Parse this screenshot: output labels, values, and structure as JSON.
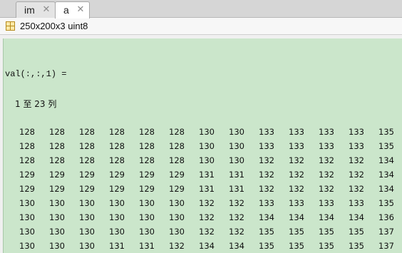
{
  "tabs": [
    {
      "label": "im",
      "active": false
    },
    {
      "label": "a",
      "active": true
    }
  ],
  "info": {
    "text": "250x200x3 uint8"
  },
  "output": {
    "val_label": "val(:,:,1) =",
    "columns_label": "1 至 23 列",
    "rows": [
      [
        "128",
        "128",
        "128",
        "128",
        "128",
        "128",
        "130",
        "130",
        "133",
        "133",
        "133",
        "133",
        "135"
      ],
      [
        "128",
        "128",
        "128",
        "128",
        "128",
        "128",
        "130",
        "130",
        "133",
        "133",
        "133",
        "133",
        "135"
      ],
      [
        "128",
        "128",
        "128",
        "128",
        "128",
        "128",
        "130",
        "130",
        "132",
        "132",
        "132",
        "132",
        "134"
      ],
      [
        "129",
        "129",
        "129",
        "129",
        "129",
        "129",
        "131",
        "131",
        "132",
        "132",
        "132",
        "132",
        "134"
      ],
      [
        "129",
        "129",
        "129",
        "129",
        "129",
        "129",
        "131",
        "131",
        "132",
        "132",
        "132",
        "132",
        "134"
      ],
      [
        "130",
        "130",
        "130",
        "130",
        "130",
        "130",
        "132",
        "132",
        "133",
        "133",
        "133",
        "133",
        "135"
      ],
      [
        "130",
        "130",
        "130",
        "130",
        "130",
        "130",
        "132",
        "132",
        "134",
        "134",
        "134",
        "134",
        "136"
      ],
      [
        "130",
        "130",
        "130",
        "130",
        "130",
        "130",
        "132",
        "132",
        "135",
        "135",
        "135",
        "135",
        "137"
      ],
      [
        "130",
        "130",
        "130",
        "131",
        "131",
        "132",
        "134",
        "134",
        "135",
        "135",
        "135",
        "135",
        "137"
      ]
    ]
  },
  "colors": {
    "content_bg": "#cbe6cb",
    "tabbar_bg": "#d6d6d6",
    "active_tab_bg": "#ffffff"
  }
}
